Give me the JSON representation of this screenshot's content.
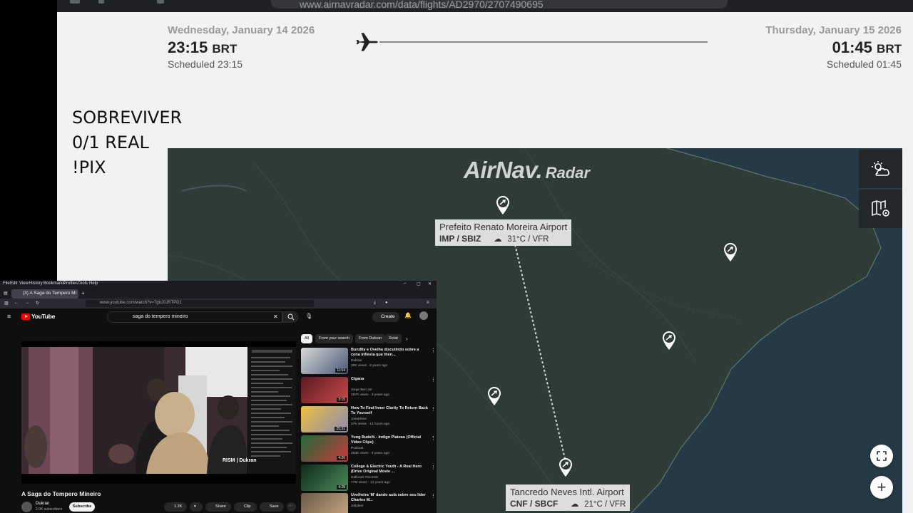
{
  "browser": {
    "url": "www.airnavradar.com/data/flights/AD2970/2707490695"
  },
  "flight": {
    "departure": {
      "date": "Wednesday, January 14 2026",
      "time": "23:15",
      "tz": "BRT",
      "scheduled": "Scheduled 23:15"
    },
    "arrival": {
      "date": "Thursday, January 15 2026",
      "time": "01:45",
      "tz": "BRT",
      "scheduled": "Scheduled 01:45"
    }
  },
  "overlay": {
    "line1": "SOBREVIVER",
    "line2": "0/1 REAL",
    "line3": "!PIX"
  },
  "map": {
    "logo_brand": "AirNav.",
    "logo_sub": "Radar",
    "origin": {
      "name": "Prefeito Renato Moreira Airport",
      "codes": "IMP / SBIZ",
      "weather": "31°C / VFR"
    },
    "destination": {
      "name": "Tancredo Neves Intl. Airport",
      "codes": "CNF / SBCF",
      "weather": "21°C / VFR"
    },
    "colors": {
      "land": "#2e3b36",
      "ocean": "#253a44",
      "route": "#d9d9d9"
    }
  },
  "pip": {
    "menu": [
      "File",
      "Edit",
      "View",
      "History",
      "Bookmarks",
      "Profiles",
      "Tools",
      "Help"
    ],
    "tab_title": "(3) A Saga do Tempero Mi",
    "url": "www.youtube.com/watch?v=7gbJ0JRTPD1",
    "yt_logo": "YouTube",
    "search_query": "saga do tempero mineiro",
    "create_label": "Create",
    "video_title": "A Saga do Tempero Mineiro",
    "watermark": "RISM | Dukran",
    "channel": "Dukran",
    "subscribers": "2.0K subscribers",
    "subscribe_label": "Subscribe",
    "actions": {
      "likes": "1.2K",
      "share": "Share",
      "clip": "Clip",
      "save": "Save"
    },
    "chips": [
      "All",
      "From your search",
      "From Dukran",
      "Relat"
    ],
    "related": [
      {
        "title": "Bundlty e Ovelha discutindo sobre a cona infiesta que then...",
        "channel": "Dukran",
        "meta": "29K views · 8 years ago",
        "duration": "11:54"
      },
      {
        "title": "Cigana",
        "channel": "Jorge Ben Jor",
        "meta": "187K views · 3 years ago",
        "duration": "3:15"
      },
      {
        "title": "How To Find Inner Clarity To Return Back To Yourself",
        "channel": "Josephine",
        "meta": "27K views · 13 hours ago",
        "duration": "25:31"
      },
      {
        "title": "Yung Buda% - Indigo Plateau (Official Video Clipe)",
        "channel": "Podcast",
        "meta": "263K views · 3 years ago",
        "duration": "4:20"
      },
      {
        "title": "College & Electric Youth - A Real Hero (Drive Original Movie ...",
        "channel": "Hallmark Records",
        "meta": "77M views · 14 years ago",
        "duration": "4:28"
      },
      {
        "title": "Uvelheira 'M' dando aula sobre seu lider Charles M...",
        "channel": "Jollybee",
        "meta": "",
        "duration": ""
      }
    ]
  }
}
